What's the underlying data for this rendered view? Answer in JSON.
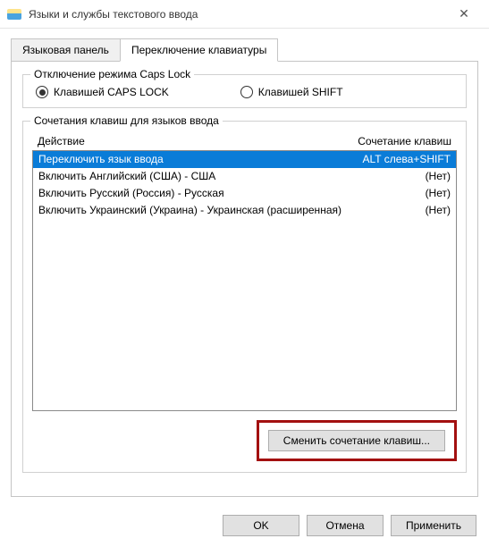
{
  "window": {
    "title": "Языки и службы текстового ввода"
  },
  "tabs": {
    "lang_panel": "Языковая панель",
    "switch_kb": "Переключение клавиатуры"
  },
  "caps_group": {
    "label": "Отключение режима Caps Lock",
    "caps_option": "Клавишей CAPS LOCK",
    "shift_option": "Клавишей SHIFT"
  },
  "hotkey_group": {
    "label": "Сочетания клавиш для языков ввода",
    "col_action": "Действие",
    "col_hotkey": "Сочетание клавиш",
    "rows": [
      {
        "action": "Переключить язык ввода",
        "hotkey": "ALT слева+SHIFT"
      },
      {
        "action": "Включить Английский (США) - США",
        "hotkey": "(Нет)"
      },
      {
        "action": "Включить Русский (Россия) - Русская",
        "hotkey": "(Нет)"
      },
      {
        "action": "Включить Украинский (Украина) - Украинская (расширенная)",
        "hotkey": "(Нет)"
      }
    ],
    "change_btn": "Сменить сочетание клавиш..."
  },
  "footer": {
    "ok": "OK",
    "cancel": "Отмена",
    "apply": "Применить"
  }
}
